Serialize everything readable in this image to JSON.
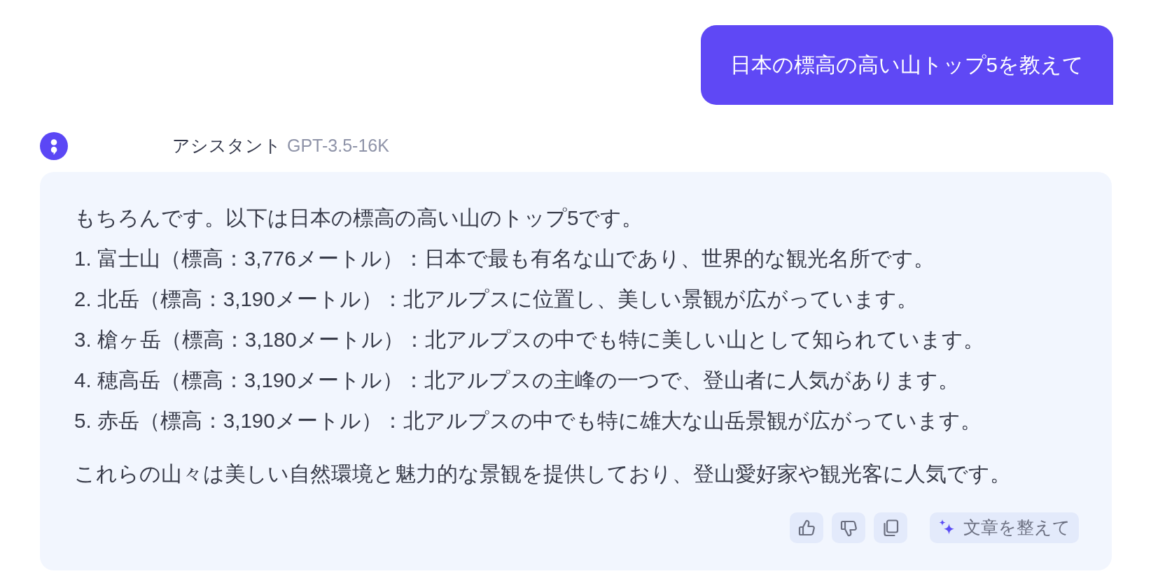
{
  "user_message": {
    "text": "日本の標高の高い山トップ5を教えて"
  },
  "assistant": {
    "name": "アシスタント",
    "model": "GPT-3.5-16K",
    "paragraphs": [
      {
        "lines": [
          "もちろんです。以下は日本の標高の高い山のトップ5です。",
          "1. 富士山（標高：3,776メートル）：日本で最も有名な山であり、世界的な観光名所です。",
          "2. 北岳（標高：3,190メートル）：北アルプスに位置し、美しい景観が広がっています。",
          "3. 槍ヶ岳（標高：3,180メートル）：北アルプスの中でも特に美しい山として知られています。",
          "4. 穂高岳（標高：3,190メートル）：北アルプスの主峰の一つで、登山者に人気があります。",
          "5. 赤岳（標高：3,190メートル）：北アルプスの中でも特に雄大な山岳景観が広がっています。"
        ]
      },
      {
        "lines": [
          "これらの山々は美しい自然環境と魅力的な景観を提供しており、登山愛好家や観光客に人気です。"
        ]
      }
    ],
    "actions": [
      {
        "kind": "like"
      },
      {
        "kind": "dislike"
      },
      {
        "kind": "copy"
      },
      {
        "kind": "polish",
        "label": "文章を整えて"
      }
    ]
  }
}
